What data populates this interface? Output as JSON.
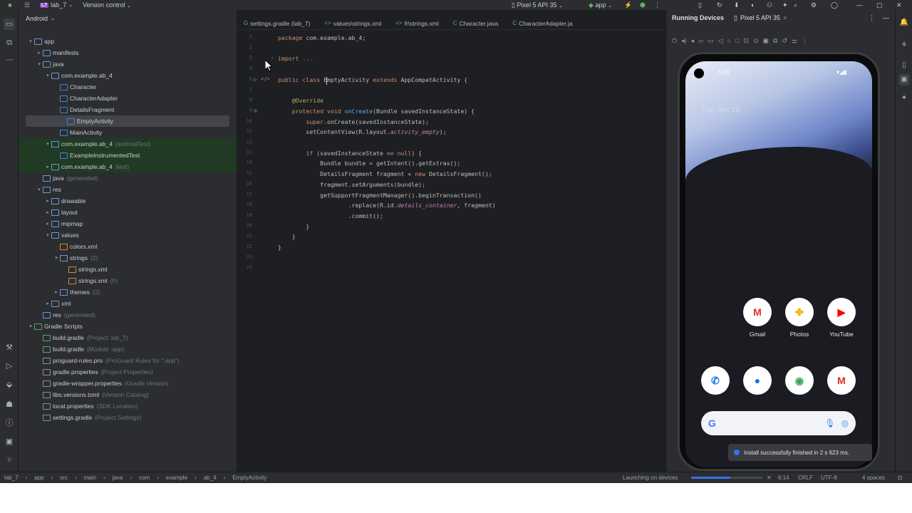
{
  "titlebar": {
    "project_badge": "L7",
    "project": "lab_7",
    "vcs": "Version control",
    "device": "Pixel 5 API 35",
    "run_config": "app"
  },
  "project_panel": {
    "view": "Android",
    "tree": [
      {
        "label": "app",
        "dim": "",
        "indent": 0,
        "arrow": "▾",
        "color": "#6b9bd6",
        "state": ""
      },
      {
        "label": "manifests",
        "dim": "",
        "indent": 1,
        "arrow": "▸",
        "color": "#6b9bd6",
        "state": ""
      },
      {
        "label": "java",
        "dim": "",
        "indent": 1,
        "arrow": "▾",
        "color": "#6b9bd6",
        "state": ""
      },
      {
        "label": "com.example.ab_4",
        "dim": "",
        "indent": 2,
        "arrow": "▾",
        "color": "#6b9bd6",
        "state": ""
      },
      {
        "label": "Character",
        "dim": "",
        "indent": 3,
        "arrow": "",
        "color": "#3e86d6",
        "state": ""
      },
      {
        "label": "CharacterAdapter",
        "dim": "",
        "indent": 3,
        "arrow": "",
        "color": "#3e86d6",
        "state": ""
      },
      {
        "label": "DetailsFragment",
        "dim": "",
        "indent": 3,
        "arrow": "",
        "color": "#3e86d6",
        "state": ""
      },
      {
        "label": "EmptyActivity",
        "dim": "",
        "indent": 3,
        "arrow": "",
        "color": "#3e86d6",
        "state": "sel"
      },
      {
        "label": "MainActivity",
        "dim": "",
        "indent": 3,
        "arrow": "",
        "color": "#3e86d6",
        "state": ""
      },
      {
        "label": "com.example.ab_4",
        "dim": "(androidTest)",
        "indent": 2,
        "arrow": "▾",
        "color": "#6b9bd6",
        "state": "green"
      },
      {
        "label": "ExampleInstrumentedTest",
        "dim": "",
        "indent": 3,
        "arrow": "",
        "color": "#3e86d6",
        "state": "green"
      },
      {
        "label": "com.example.ab_4",
        "dim": "(test)",
        "indent": 2,
        "arrow": "▸",
        "color": "#6b9bd6",
        "state": "green"
      },
      {
        "label": "java",
        "dim": "(generated)",
        "indent": 1,
        "arrow": "",
        "color": "#6b9bd6",
        "state": ""
      },
      {
        "label": "res",
        "dim": "",
        "indent": 1,
        "arrow": "▾",
        "color": "#6b9bd6",
        "state": ""
      },
      {
        "label": "drawable",
        "dim": "",
        "indent": 2,
        "arrow": "▸",
        "color": "#6b9bd6",
        "state": ""
      },
      {
        "label": "layout",
        "dim": "",
        "indent": 2,
        "arrow": "▸",
        "color": "#6b9bd6",
        "state": ""
      },
      {
        "label": "mipmap",
        "dim": "",
        "indent": 2,
        "arrow": "▸",
        "color": "#6b9bd6",
        "state": ""
      },
      {
        "label": "values",
        "dim": "",
        "indent": 2,
        "arrow": "▾",
        "color": "#6b9bd6",
        "state": ""
      },
      {
        "label": "colors.xml",
        "dim": "",
        "indent": 3,
        "arrow": "",
        "color": "#d48a3c",
        "state": ""
      },
      {
        "label": "strings",
        "dim": "(2)",
        "indent": 3,
        "arrow": "▾",
        "color": "#6b9bd6",
        "state": ""
      },
      {
        "label": "strings.xml",
        "dim": "",
        "indent": 4,
        "arrow": "",
        "color": "#d48a3c",
        "state": ""
      },
      {
        "label": "strings.xml",
        "dim": "(fr)",
        "indent": 4,
        "arrow": "",
        "color": "#d48a3c",
        "state": ""
      },
      {
        "label": "themes",
        "dim": "(2)",
        "indent": 3,
        "arrow": "▸",
        "color": "#6b9bd6",
        "state": ""
      },
      {
        "label": "xml",
        "dim": "",
        "indent": 2,
        "arrow": "▸",
        "color": "#6b9bd6",
        "state": ""
      },
      {
        "label": "res",
        "dim": "(generated)",
        "indent": 1,
        "arrow": "",
        "color": "#6b9bd6",
        "state": ""
      },
      {
        "label": "Gradle Scripts",
        "dim": "",
        "indent": 0,
        "arrow": "▾",
        "color": "#5aa66a",
        "state": ""
      },
      {
        "label": "build.gradle",
        "dim": "(Project: lab_7)",
        "indent": 1,
        "arrow": "",
        "color": "#5aa66a",
        "state": ""
      },
      {
        "label": "build.gradle",
        "dim": "(Module :app)",
        "indent": 1,
        "arrow": "",
        "color": "#5aa66a",
        "state": ""
      },
      {
        "label": "proguard-rules.pro",
        "dim": "(ProGuard Rules for \":app\")",
        "indent": 1,
        "arrow": "",
        "color": "#8c8f96",
        "state": ""
      },
      {
        "label": "gradle.properties",
        "dim": "(Project Properties)",
        "indent": 1,
        "arrow": "",
        "color": "#8c8f96",
        "state": ""
      },
      {
        "label": "gradle-wrapper.properties",
        "dim": "(Gradle Version)",
        "indent": 1,
        "arrow": "",
        "color": "#8c8f96",
        "state": ""
      },
      {
        "label": "libs.versions.toml",
        "dim": "(Version Catalog)",
        "indent": 1,
        "arrow": "",
        "color": "#8c8f96",
        "state": ""
      },
      {
        "label": "local.properties",
        "dim": "(SDK Location)",
        "indent": 1,
        "arrow": "",
        "color": "#8c8f96",
        "state": ""
      },
      {
        "label": "settings.gradle",
        "dim": "(Project Settings)",
        "indent": 1,
        "arrow": "",
        "color": "#5aa66a",
        "state": ""
      }
    ]
  },
  "editor": {
    "tabs": [
      {
        "label": "settings.gradle (lab_7)",
        "icon": "G"
      },
      {
        "label": "values\\strings.xml",
        "icon": "<>"
      },
      {
        "label": "fr\\strings.xml",
        "icon": "<>"
      },
      {
        "label": "Character.java",
        "icon": "C"
      },
      {
        "label": "CharacterAdapter.ja",
        "icon": "C"
      }
    ],
    "lines": [
      {
        "n": "1",
        "html": "<span class=\"kw\">package</span> com.example.ab_4;"
      },
      {
        "n": "2",
        "html": ""
      },
      {
        "n": "3",
        "html": "<span class=\"kw\">import</span> <span class=\"cm\">...</span>"
      },
      {
        "n": "4",
        "html": ""
      },
      {
        "n": "6",
        "html": "<span class=\"kw\">public class</span> EmptyActivity <span class=\"kw\">extends</span> AppCompatActivity {"
      },
      {
        "n": "7",
        "html": ""
      },
      {
        "n": "8",
        "html": "    <span class=\"an\">@Override</span>"
      },
      {
        "n": "9",
        "html": "    <span class=\"kw\">protected void</span> <span class=\"fn\">onCreate</span>(Bundle savedInstanceState) {"
      },
      {
        "n": "10",
        "html": "        <span class=\"kw\">super</span>.onCreate(savedInstanceState);"
      },
      {
        "n": "11",
        "html": "        setContentView(R.layout.<span class=\"it\">activity_empty</span>);"
      },
      {
        "n": "12",
        "html": ""
      },
      {
        "n": "13",
        "html": "        <span class=\"kw\">if</span> (savedInstanceState == <span class=\"kw\">null</span>) {"
      },
      {
        "n": "14",
        "html": "            Bundle bundle = getIntent().getExtras();"
      },
      {
        "n": "15",
        "html": "            DetailsFragment fragment = <span class=\"kw\">new</span> DetailsFragment();"
      },
      {
        "n": "16",
        "html": "            fragment.setArguments(bundle);"
      },
      {
        "n": "17",
        "html": "            getSupportFragmentManager().beginTransaction()"
      },
      {
        "n": "18",
        "html": "                    .replace(R.id.<span class=\"it\">details_container</span>, fragment)"
      },
      {
        "n": "19",
        "html": "                    .commit();"
      },
      {
        "n": "20",
        "html": "        }"
      },
      {
        "n": "21",
        "html": "    }"
      },
      {
        "n": "22",
        "html": "}"
      },
      {
        "n": "23",
        "html": ""
      },
      {
        "n": "24",
        "html": ""
      }
    ]
  },
  "running_devices": {
    "title": "Running Devices",
    "device_tab": "Pixel 5 API 35",
    "phone": {
      "time": "5:16",
      "date": "Tue, Dec 10",
      "apps_row1": [
        {
          "label": "Gmail",
          "glyph": "M",
          "color": "#d93025"
        },
        {
          "label": "Photos",
          "glyph": "✤",
          "color": "#f4b400"
        },
        {
          "label": "YouTube",
          "glyph": "▶",
          "color": "#ff0000"
        }
      ],
      "dock": [
        {
          "glyph": "✆",
          "color": "#1a73e8"
        },
        {
          "glyph": "●",
          "color": "#1a73e8"
        },
        {
          "glyph": "◉",
          "color": "#34a853"
        },
        {
          "glyph": "M",
          "color": "#d93025"
        }
      ],
      "search_logo": "G"
    },
    "toast": "Install successfully finished in 2 s 623 ms."
  },
  "statusbar": {
    "breadcrumb": [
      "lab_7",
      "app",
      "src",
      "main",
      "java",
      "com",
      "example",
      "ab_4",
      "EmptyActivity"
    ],
    "task": "Launching on devices",
    "position": "6:14",
    "line_sep": "CRLF",
    "encoding": "UTF-8",
    "indent": "4 spaces"
  }
}
